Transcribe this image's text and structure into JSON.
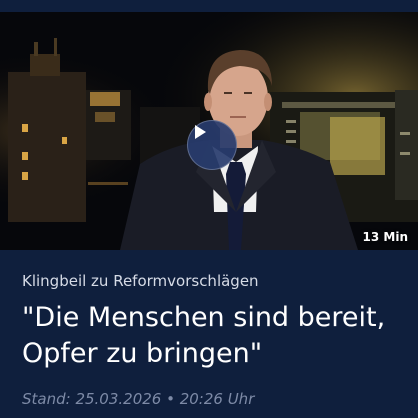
{
  "video": {
    "duration": "13 Min",
    "play_icon": "play-icon"
  },
  "article": {
    "topic": "Klingbeil zu Reformvorschlägen",
    "headline": "\"Die Menschen sind bereit, Opfer zu bringen\"",
    "stand": "Stand: 25.03.2026 • 20:26 Uhr"
  },
  "colors": {
    "background": "#0f1f3d",
    "headline_text": "#ffffff",
    "meta_text": "#7d8aa6",
    "play_button": "#283c6e"
  }
}
